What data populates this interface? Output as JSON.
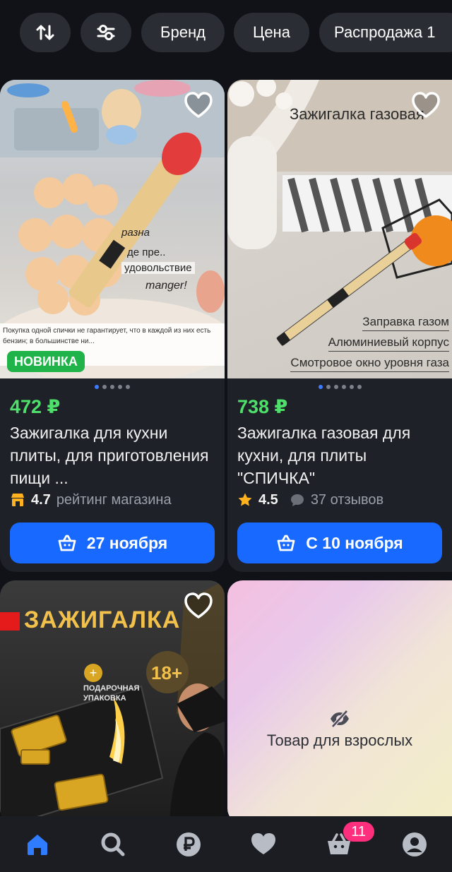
{
  "filters": {
    "sort_icon": "sort-arrows-icon",
    "settings_icon": "sliders-icon",
    "chips": [
      "Бренд",
      "Цена",
      "Распродажа 1"
    ]
  },
  "products": [
    {
      "price": "472 ₽",
      "title": "Зажигалка для кухни плиты, для приготовления пищи ...",
      "badge": "НОВИНКА",
      "rating_icon": "shop-icon",
      "rating_value": "4.7",
      "rating_text": "рейтинг магазина",
      "delivery": "27 ноября",
      "image_text": [
        "разна",
        "де пре..",
        "удовольствие",
        "manger!"
      ],
      "fine_print": "Покупка одной спички не гарантирует, что в каждой из них есть бензин; в большинстве ни..."
    },
    {
      "price": "738 ₽",
      "title": "Зажигалка газовая для кухни, для плиты \"СПИЧКА\"",
      "rating_icon": "star-icon",
      "rating_value": "4.5",
      "reviews": "37 отзывов",
      "delivery": "С 10 ноября",
      "image_title": "Зажигалка газовая",
      "image_lines": [
        "Заправка газом",
        "Алюминиевый корпус",
        "Смотровое окно уровня газа"
      ]
    },
    {
      "banner": "ЗАЖИГАЛКА",
      "age": "18+",
      "gift_label": "ПОДАРОЧНАЯ УПАКОВКА"
    },
    {
      "hidden_label": "Товар для взрослых"
    }
  ],
  "bottom_nav": {
    "items": [
      "home-icon",
      "search-icon",
      "ruble-icon",
      "heart-icon",
      "cart-icon",
      "profile-icon"
    ],
    "cart_badge": "11"
  },
  "colors": {
    "price": "#4ee06b",
    "button": "#1869ff",
    "badge": "#1fb34a",
    "cart_badge": "#ff2f7e",
    "nav_active": "#2f7cff"
  }
}
